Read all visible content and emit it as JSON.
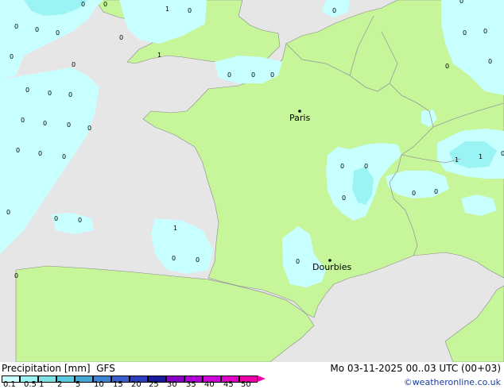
{
  "legend": {
    "title": "Precipitation [mm]",
    "model": "GFS",
    "ticks": [
      "0.1",
      "0.5",
      "1",
      "2",
      "5",
      "10",
      "15",
      "20",
      "25",
      "30",
      "35",
      "40",
      "45",
      "50"
    ],
    "colors": [
      "#c8ffff",
      "#9bf4f4",
      "#7de2e8",
      "#5ccbe0",
      "#42a8d8",
      "#3f82d2",
      "#3b5fce",
      "#2c3fbe",
      "#1a1a9e",
      "#8800c8",
      "#b400d8",
      "#d000d8",
      "#e000c8",
      "#f000a8"
    ]
  },
  "valid_time": "Mo 03-11-2025 00..03 UTC (00+03)",
  "credit": "©weatheronline.co.uk",
  "cities": [
    {
      "name": "Paris"
    },
    {
      "name": "Dourbies"
    }
  ],
  "grid_values": [
    "0",
    "0",
    "0",
    "0",
    "0",
    "0",
    "1",
    "0",
    "1",
    "0",
    "0",
    "0",
    "0",
    "0",
    "0",
    "0",
    "0",
    "0",
    "0",
    "0",
    "0",
    "0",
    "0",
    "0",
    "0",
    "0",
    "0",
    "0",
    "0",
    "0",
    "0",
    "0",
    "0",
    "0",
    "0",
    "0",
    "1",
    "0",
    "0",
    "0",
    "1",
    "1",
    "0",
    "0",
    "0",
    "0"
  ],
  "colors": {
    "land": "#c6f59a",
    "sea": "#e6e6e6",
    "light_precip": "#c8ffff",
    "mid_precip": "#9bf4f4",
    "borders": "#9a9a9a"
  }
}
